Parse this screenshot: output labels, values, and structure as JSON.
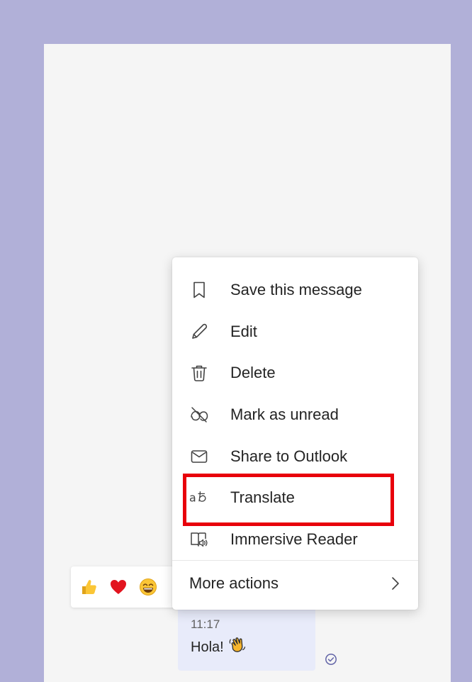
{
  "context_menu": {
    "items": [
      {
        "label": "Save this message",
        "icon": "bookmark-icon"
      },
      {
        "label": "Edit",
        "icon": "pencil-icon"
      },
      {
        "label": "Delete",
        "icon": "trash-icon"
      },
      {
        "label": "Mark as unread",
        "icon": "mark-unread-icon"
      },
      {
        "label": "Share to Outlook",
        "icon": "mail-icon"
      },
      {
        "label": "Translate",
        "icon": "translate-icon"
      },
      {
        "label": "Immersive Reader",
        "icon": "immersive-reader-icon"
      }
    ],
    "more_actions": {
      "label": "More actions",
      "icon": "chevron-right-icon"
    }
  },
  "reactions": [
    {
      "name": "like",
      "icon": "thumbs-up-icon"
    },
    {
      "name": "heart",
      "icon": "heart-icon"
    },
    {
      "name": "laugh",
      "icon": "laughing-face-icon"
    }
  ],
  "message": {
    "time": "11:17",
    "text": "Hola!",
    "emoji": "waving-hand-icon",
    "status_icon": "read-receipt-icon"
  },
  "highlight": {
    "target": "Translate",
    "color": "#e8000b"
  },
  "colors": {
    "background": "#b1b0d8",
    "pane": "#f5f5f5",
    "bubble": "#e8ebfa",
    "accent": "#6264a7"
  }
}
